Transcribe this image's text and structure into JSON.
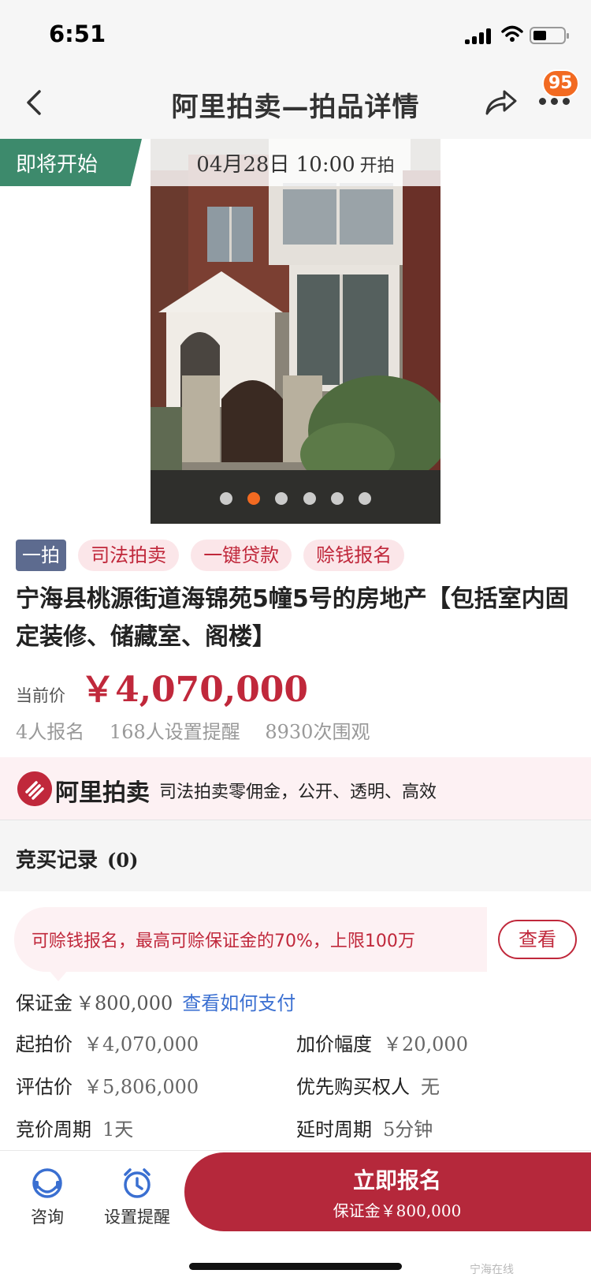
{
  "status_bar": {
    "time": "6:51"
  },
  "nav": {
    "title": "阿里拍卖—拍品详情",
    "badge": "95"
  },
  "hero": {
    "status": "即将开始",
    "start_time": "04月28日 10:00",
    "start_suffix": "开拍",
    "slide_count": 6,
    "active_slide": 1
  },
  "tags": [
    "一拍",
    "司法拍卖",
    "一键贷款",
    "赊钱报名"
  ],
  "lot": {
    "title": "宁海县桃源街道海锦苑5幢5号的房地产【包括室内固定装修、储藏室、阁楼】",
    "price_label": "当前价",
    "price": "￥4,070,000",
    "stats": [
      "4人报名",
      "168人设置提醒",
      "8930次围观"
    ]
  },
  "ali_banner": {
    "logo_text": "阿里拍卖",
    "slogan": "司法拍卖零佣金，公开、透明、高效"
  },
  "bid_record": {
    "label": "竞买记录",
    "count": "(0)"
  },
  "credit_info": {
    "text": "可赊钱报名，最高可赊保证金的70%，上限100万",
    "button": "查看"
  },
  "deposit": {
    "label": "保证金",
    "value": "￥800,000",
    "link": "查看如何支付"
  },
  "details": {
    "start_price_label": "起拍价",
    "start_price": "￥4,070,000",
    "increment_label": "加价幅度",
    "increment": "￥20,000",
    "appraisal_label": "评估价",
    "appraisal": "￥5,806,000",
    "priority_label": "优先购买权人",
    "priority": "无",
    "cycle_label": "竞价周期",
    "cycle": "1天",
    "delay_label": "延时周期",
    "delay": "5分钟"
  },
  "bottom": {
    "consult": "咨询",
    "reminder": "设置提醒",
    "signup": "立即报名",
    "signup_sub": "保证金￥800,000"
  },
  "watermark": "宁海在线",
  "colors": {
    "accent": "#c0283b",
    "status_green": "#3d8a6c",
    "badge": "#f26a21",
    "link": "#3a6fd1"
  }
}
